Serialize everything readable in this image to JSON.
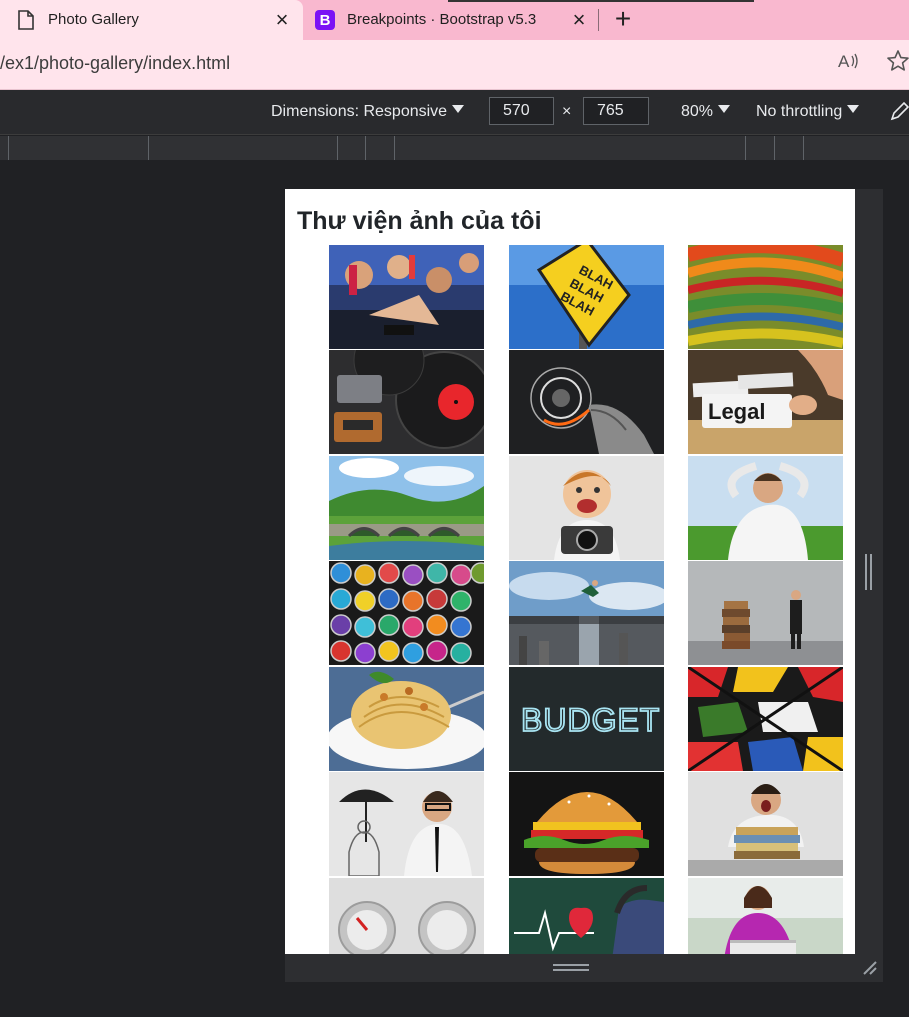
{
  "browser": {
    "tabs": [
      {
        "title": "Photo Gallery",
        "icon": "page-icon",
        "active": true
      },
      {
        "title": "Breakpoints · Bootstrap v5.3",
        "icon": "bootstrap-icon",
        "icon_letter": "B",
        "active": false
      }
    ],
    "close_glyph": "×",
    "new_tab_glyph": "+",
    "url": "/ex1/photo-gallery/index.html"
  },
  "devtools": {
    "dimensions_label": "Dimensions: Responsive",
    "width": "570",
    "times": "×",
    "height": "765",
    "zoom": "80%",
    "throttling": "No throttling"
  },
  "page": {
    "title": "Thư viện ảnh của tôi",
    "photos": [
      "crowd-concert",
      "blah-blah-sign",
      "colorful-stripes",
      "records-cassettes",
      "digital-dial-hand",
      "legal-folder",
      "stone-bridge-landscape",
      "boy-with-camera",
      "relaxed-man-field",
      "spray-paint-cans",
      "man-jumping-bridge",
      "man-with-books",
      "pasta-dish",
      "budget-chalkboard",
      "graffiti-wall",
      "businessman-umbrella",
      "burger",
      "yawning-man-papers",
      "knob-controls",
      "heartbeat-chalkboard",
      "woman-laptop"
    ]
  },
  "colors": {
    "tabstrip": "#f9b8cf",
    "active_tab": "#ffe4ec",
    "devtools_bg": "#292a2d",
    "outer_bg": "#202124",
    "bootstrap_purple": "#7b12f5"
  }
}
